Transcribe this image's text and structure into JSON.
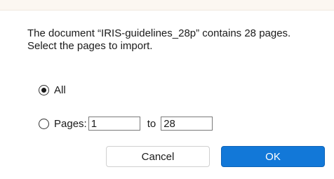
{
  "dialog": {
    "message_line1": "The document “IRIS-guidelines_28p” contains 28 pages.",
    "message_line2": "Select the pages to import.",
    "options": {
      "all_label": "All",
      "all_selected": true,
      "pages_label": "Pages:",
      "pages_selected": false,
      "from_value": "1",
      "to_label": "to",
      "to_value": "28"
    },
    "buttons": {
      "cancel_label": "Cancel",
      "ok_label": "OK"
    }
  },
  "colors": {
    "ok_button": "#1278d8",
    "top_strip": "#fcf7f1"
  }
}
